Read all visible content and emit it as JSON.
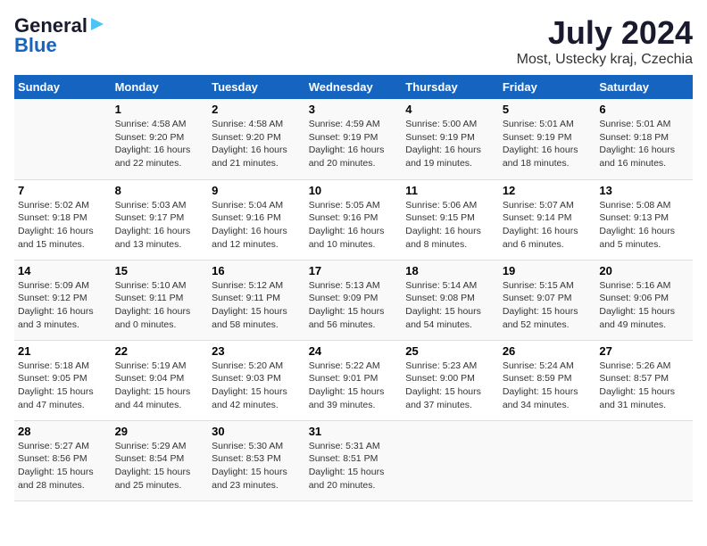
{
  "header": {
    "logo_general": "General",
    "logo_blue": "Blue",
    "month_title": "July 2024",
    "location": "Most, Ustecky kraj, Czechia"
  },
  "calendar": {
    "days_of_week": [
      "Sunday",
      "Monday",
      "Tuesday",
      "Wednesday",
      "Thursday",
      "Friday",
      "Saturday"
    ],
    "weeks": [
      [
        {
          "date": "",
          "info": ""
        },
        {
          "date": "1",
          "info": "Sunrise: 4:58 AM\nSunset: 9:20 PM\nDaylight: 16 hours\nand 22 minutes."
        },
        {
          "date": "2",
          "info": "Sunrise: 4:58 AM\nSunset: 9:20 PM\nDaylight: 16 hours\nand 21 minutes."
        },
        {
          "date": "3",
          "info": "Sunrise: 4:59 AM\nSunset: 9:19 PM\nDaylight: 16 hours\nand 20 minutes."
        },
        {
          "date": "4",
          "info": "Sunrise: 5:00 AM\nSunset: 9:19 PM\nDaylight: 16 hours\nand 19 minutes."
        },
        {
          "date": "5",
          "info": "Sunrise: 5:01 AM\nSunset: 9:19 PM\nDaylight: 16 hours\nand 18 minutes."
        },
        {
          "date": "6",
          "info": "Sunrise: 5:01 AM\nSunset: 9:18 PM\nDaylight: 16 hours\nand 16 minutes."
        }
      ],
      [
        {
          "date": "7",
          "info": "Sunrise: 5:02 AM\nSunset: 9:18 PM\nDaylight: 16 hours\nand 15 minutes."
        },
        {
          "date": "8",
          "info": "Sunrise: 5:03 AM\nSunset: 9:17 PM\nDaylight: 16 hours\nand 13 minutes."
        },
        {
          "date": "9",
          "info": "Sunrise: 5:04 AM\nSunset: 9:16 PM\nDaylight: 16 hours\nand 12 minutes."
        },
        {
          "date": "10",
          "info": "Sunrise: 5:05 AM\nSunset: 9:16 PM\nDaylight: 16 hours\nand 10 minutes."
        },
        {
          "date": "11",
          "info": "Sunrise: 5:06 AM\nSunset: 9:15 PM\nDaylight: 16 hours\nand 8 minutes."
        },
        {
          "date": "12",
          "info": "Sunrise: 5:07 AM\nSunset: 9:14 PM\nDaylight: 16 hours\nand 6 minutes."
        },
        {
          "date": "13",
          "info": "Sunrise: 5:08 AM\nSunset: 9:13 PM\nDaylight: 16 hours\nand 5 minutes."
        }
      ],
      [
        {
          "date": "14",
          "info": "Sunrise: 5:09 AM\nSunset: 9:12 PM\nDaylight: 16 hours\nand 3 minutes."
        },
        {
          "date": "15",
          "info": "Sunrise: 5:10 AM\nSunset: 9:11 PM\nDaylight: 16 hours\nand 0 minutes."
        },
        {
          "date": "16",
          "info": "Sunrise: 5:12 AM\nSunset: 9:11 PM\nDaylight: 15 hours\nand 58 minutes."
        },
        {
          "date": "17",
          "info": "Sunrise: 5:13 AM\nSunset: 9:09 PM\nDaylight: 15 hours\nand 56 minutes."
        },
        {
          "date": "18",
          "info": "Sunrise: 5:14 AM\nSunset: 9:08 PM\nDaylight: 15 hours\nand 54 minutes."
        },
        {
          "date": "19",
          "info": "Sunrise: 5:15 AM\nSunset: 9:07 PM\nDaylight: 15 hours\nand 52 minutes."
        },
        {
          "date": "20",
          "info": "Sunrise: 5:16 AM\nSunset: 9:06 PM\nDaylight: 15 hours\nand 49 minutes."
        }
      ],
      [
        {
          "date": "21",
          "info": "Sunrise: 5:18 AM\nSunset: 9:05 PM\nDaylight: 15 hours\nand 47 minutes."
        },
        {
          "date": "22",
          "info": "Sunrise: 5:19 AM\nSunset: 9:04 PM\nDaylight: 15 hours\nand 44 minutes."
        },
        {
          "date": "23",
          "info": "Sunrise: 5:20 AM\nSunset: 9:03 PM\nDaylight: 15 hours\nand 42 minutes."
        },
        {
          "date": "24",
          "info": "Sunrise: 5:22 AM\nSunset: 9:01 PM\nDaylight: 15 hours\nand 39 minutes."
        },
        {
          "date": "25",
          "info": "Sunrise: 5:23 AM\nSunset: 9:00 PM\nDaylight: 15 hours\nand 37 minutes."
        },
        {
          "date": "26",
          "info": "Sunrise: 5:24 AM\nSunset: 8:59 PM\nDaylight: 15 hours\nand 34 minutes."
        },
        {
          "date": "27",
          "info": "Sunrise: 5:26 AM\nSunset: 8:57 PM\nDaylight: 15 hours\nand 31 minutes."
        }
      ],
      [
        {
          "date": "28",
          "info": "Sunrise: 5:27 AM\nSunset: 8:56 PM\nDaylight: 15 hours\nand 28 minutes."
        },
        {
          "date": "29",
          "info": "Sunrise: 5:29 AM\nSunset: 8:54 PM\nDaylight: 15 hours\nand 25 minutes."
        },
        {
          "date": "30",
          "info": "Sunrise: 5:30 AM\nSunset: 8:53 PM\nDaylight: 15 hours\nand 23 minutes."
        },
        {
          "date": "31",
          "info": "Sunrise: 5:31 AM\nSunset: 8:51 PM\nDaylight: 15 hours\nand 20 minutes."
        },
        {
          "date": "",
          "info": ""
        },
        {
          "date": "",
          "info": ""
        },
        {
          "date": "",
          "info": ""
        }
      ]
    ]
  }
}
